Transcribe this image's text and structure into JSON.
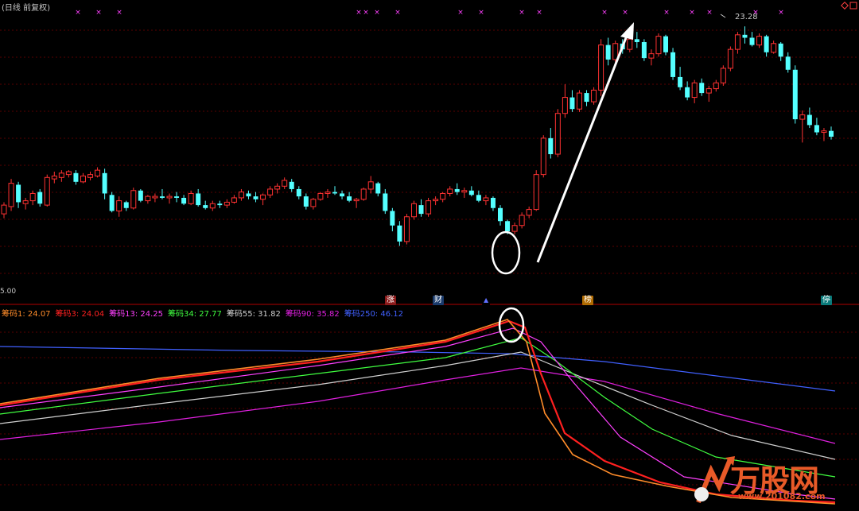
{
  "header": {
    "title": "(日线 前复权)"
  },
  "price_axis": {
    "floor_label": "5.00"
  },
  "peak_label": "23.28",
  "event_tags": [
    {
      "label": "涨",
      "bg": "#8b1a1a"
    },
    {
      "label": "财",
      "bg": "#1a3a6b"
    },
    {
      "label": "▲",
      "bg": "#000000"
    },
    {
      "label": "榜",
      "bg": "#b06a00"
    },
    {
      "label": "停",
      "bg": "#0a7a7a"
    }
  ],
  "legend": [
    {
      "label": "筹码1: 24.07",
      "color": "#ff8c2a"
    },
    {
      "label": "筹码3: 24.04",
      "color": "#ff2020"
    },
    {
      "label": "筹码13: 24.25",
      "color": "#ff40ff"
    },
    {
      "label": "筹码34: 27.77",
      "color": "#40ff40"
    },
    {
      "label": "筹码55: 31.82",
      "color": "#d0d0d0"
    },
    {
      "label": "筹码90: 35.82",
      "color": "#e020e0"
    },
    {
      "label": "筹码250: 46.12",
      "color": "#4060ff"
    }
  ],
  "watermark": {
    "logo_text": "万股网",
    "url": "www.201082.com"
  },
  "colors": {
    "up": "#ff3232",
    "down": "#54ffff",
    "grid": "#5a0000",
    "divider": "#b00000",
    "marker": "#ff40ff",
    "arrow": "#ffffff"
  },
  "chart_data": {
    "type": "candlestick",
    "price_range": [
      5.0,
      24.0
    ],
    "candles": [
      [
        10.4,
        11.2,
        10.1,
        11.0
      ],
      [
        10.9,
        12.8,
        10.6,
        12.5
      ],
      [
        12.4,
        12.6,
        10.8,
        11.2
      ],
      [
        11.1,
        11.5,
        10.7,
        11.3
      ],
      [
        11.3,
        12.0,
        11.0,
        11.8
      ],
      [
        11.9,
        12.1,
        10.9,
        11.1
      ],
      [
        11.0,
        13.1,
        10.9,
        12.9
      ],
      [
        12.8,
        13.3,
        12.5,
        13.0
      ],
      [
        12.9,
        13.4,
        12.6,
        13.2
      ],
      [
        13.1,
        13.4,
        12.9,
        13.3
      ],
      [
        13.2,
        13.4,
        12.4,
        12.6
      ],
      [
        12.6,
        13.2,
        12.5,
        13.0
      ],
      [
        12.9,
        13.3,
        12.7,
        13.1
      ],
      [
        13.0,
        13.6,
        12.9,
        13.4
      ],
      [
        13.2,
        13.5,
        11.4,
        11.8
      ],
      [
        11.7,
        11.9,
        10.5,
        10.6
      ],
      [
        10.6,
        11.6,
        10.2,
        11.3
      ],
      [
        11.2,
        11.3,
        10.6,
        10.8
      ],
      [
        10.8,
        12.2,
        10.7,
        12.0
      ],
      [
        12.0,
        12.1,
        11.2,
        11.3
      ],
      [
        11.3,
        11.7,
        11.1,
        11.6
      ],
      [
        11.5,
        11.8,
        11.2,
        11.6
      ],
      [
        11.6,
        12.1,
        11.4,
        11.5
      ],
      [
        11.5,
        11.8,
        11.1,
        11.6
      ],
      [
        11.6,
        11.9,
        11.2,
        11.5
      ],
      [
        11.5,
        11.7,
        11.0,
        11.1
      ],
      [
        11.1,
        12.0,
        11.0,
        11.8
      ],
      [
        11.8,
        12.1,
        10.9,
        11.0
      ],
      [
        11.0,
        11.3,
        10.7,
        10.8
      ],
      [
        10.8,
        11.3,
        10.6,
        11.1
      ],
      [
        11.1,
        11.3,
        10.8,
        11.0
      ],
      [
        11.0,
        11.4,
        10.8,
        11.2
      ],
      [
        11.2,
        11.7,
        11.1,
        11.5
      ],
      [
        11.5,
        12.1,
        11.3,
        11.9
      ],
      [
        11.8,
        12.0,
        11.4,
        11.6
      ],
      [
        11.6,
        11.9,
        11.2,
        11.4
      ],
      [
        11.4,
        11.8,
        11.0,
        11.7
      ],
      [
        11.7,
        12.3,
        11.5,
        12.1
      ],
      [
        12.1,
        12.5,
        11.8,
        12.3
      ],
      [
        12.3,
        12.9,
        12.1,
        12.7
      ],
      [
        12.6,
        12.8,
        11.9,
        12.1
      ],
      [
        12.1,
        12.3,
        11.4,
        11.6
      ],
      [
        11.6,
        11.8,
        10.7,
        10.9
      ],
      [
        10.9,
        11.5,
        10.7,
        11.4
      ],
      [
        11.4,
        11.9,
        11.3,
        11.8
      ],
      [
        11.8,
        12.1,
        11.5,
        11.9
      ],
      [
        11.9,
        12.3,
        11.7,
        11.8
      ],
      [
        11.8,
        12.0,
        11.4,
        11.6
      ],
      [
        11.6,
        11.9,
        11.2,
        11.3
      ],
      [
        11.3,
        11.5,
        10.8,
        11.4
      ],
      [
        11.4,
        12.2,
        11.3,
        12.1
      ],
      [
        12.1,
        13.0,
        11.8,
        12.6
      ],
      [
        12.5,
        12.6,
        11.6,
        11.8
      ],
      [
        11.8,
        12.1,
        10.4,
        10.6
      ],
      [
        10.6,
        10.8,
        9.2,
        9.6
      ],
      [
        9.6,
        9.9,
        8.2,
        8.5
      ],
      [
        8.5,
        10.4,
        8.3,
        10.2
      ],
      [
        10.2,
        11.3,
        10.0,
        11.1
      ],
      [
        11.0,
        11.4,
        10.2,
        10.4
      ],
      [
        10.4,
        11.5,
        10.2,
        11.3
      ],
      [
        11.3,
        11.6,
        11.0,
        11.4
      ],
      [
        11.4,
        11.9,
        11.2,
        11.8
      ],
      [
        11.8,
        12.3,
        11.6,
        12.1
      ],
      [
        12.1,
        12.5,
        11.7,
        11.9
      ],
      [
        11.9,
        12.2,
        11.5,
        12.0
      ],
      [
        12.0,
        12.3,
        11.6,
        11.7
      ],
      [
        11.7,
        12.0,
        11.2,
        11.3
      ],
      [
        11.3,
        11.7,
        11.0,
        11.5
      ],
      [
        11.5,
        11.6,
        10.6,
        10.8
      ],
      [
        10.8,
        11.0,
        9.6,
        9.9
      ],
      [
        9.9,
        10.0,
        9.0,
        9.2
      ],
      [
        9.2,
        9.8,
        9.0,
        9.6
      ],
      [
        9.6,
        10.5,
        9.4,
        10.3
      ],
      [
        10.3,
        10.9,
        10.1,
        10.7
      ],
      [
        10.7,
        13.4,
        10.6,
        13.1
      ],
      [
        13.1,
        15.8,
        12.9,
        15.6
      ],
      [
        15.6,
        16.3,
        14.2,
        14.5
      ],
      [
        14.5,
        17.6,
        14.3,
        17.3
      ],
      [
        17.3,
        19.3,
        17.0,
        18.4
      ],
      [
        18.4,
        18.9,
        17.4,
        17.6
      ],
      [
        17.6,
        18.9,
        17.4,
        18.7
      ],
      [
        18.7,
        18.9,
        17.8,
        18.1
      ],
      [
        18.1,
        19.1,
        17.9,
        18.9
      ],
      [
        18.9,
        22.4,
        18.5,
        22.0
      ],
      [
        22.0,
        22.5,
        20.6,
        21.0
      ],
      [
        21.0,
        22.3,
        20.8,
        22.1
      ],
      [
        22.1,
        22.4,
        21.4,
        21.7
      ],
      [
        21.7,
        22.6,
        21.5,
        22.4
      ],
      [
        22.4,
        22.9,
        21.8,
        22.2
      ],
      [
        22.2,
        22.4,
        20.9,
        21.1
      ],
      [
        21.1,
        21.7,
        20.6,
        21.4
      ],
      [
        21.4,
        22.8,
        21.2,
        22.6
      ],
      [
        22.6,
        22.7,
        21.3,
        21.5
      ],
      [
        21.5,
        21.8,
        19.6,
        19.8
      ],
      [
        19.8,
        20.5,
        18.9,
        19.1
      ],
      [
        19.1,
        19.5,
        18.2,
        18.4
      ],
      [
        18.4,
        19.6,
        18.0,
        19.4
      ],
      [
        19.4,
        19.7,
        18.5,
        18.7
      ],
      [
        18.7,
        19.2,
        18.1,
        19.0
      ],
      [
        19.0,
        19.6,
        18.8,
        19.4
      ],
      [
        19.4,
        20.6,
        19.2,
        20.4
      ],
      [
        20.4,
        21.9,
        20.2,
        21.7
      ],
      [
        21.7,
        22.9,
        21.4,
        22.7
      ],
      [
        22.7,
        23.28,
        22.1,
        22.5
      ],
      [
        22.5,
        22.9,
        21.9,
        22.0
      ],
      [
        22.0,
        22.8,
        21.8,
        22.6
      ],
      [
        22.6,
        22.7,
        21.2,
        21.5
      ],
      [
        21.5,
        22.3,
        21.4,
        22.1
      ],
      [
        22.1,
        22.2,
        20.9,
        21.2
      ],
      [
        21.2,
        21.5,
        20.1,
        20.3
      ],
      [
        20.3,
        20.6,
        16.6,
        16.9
      ],
      [
        16.9,
        17.5,
        15.3,
        17.2
      ],
      [
        17.2,
        17.7,
        16.3,
        16.5
      ],
      [
        16.5,
        17.0,
        15.8,
        16.0
      ],
      [
        16.0,
        16.3,
        15.4,
        16.1
      ],
      [
        16.1,
        16.4,
        15.5,
        15.7
      ]
    ]
  }
}
